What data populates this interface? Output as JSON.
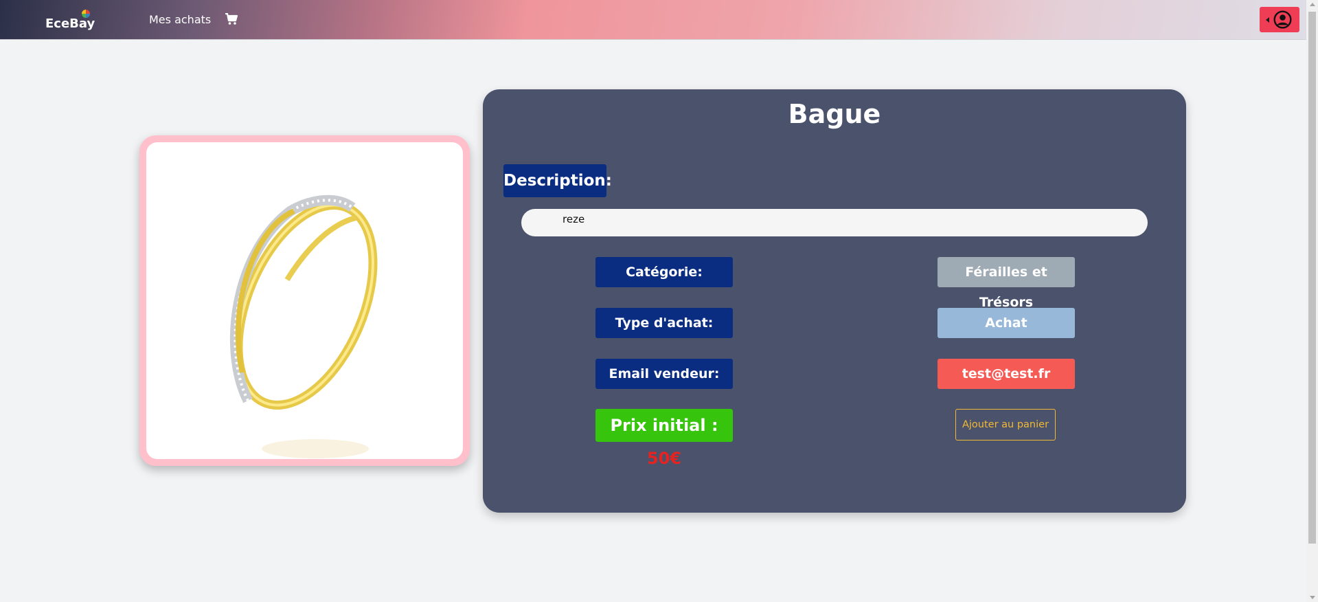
{
  "navbar": {
    "logo_text": "EceBay",
    "links": [
      {
        "label": "Mes achats"
      }
    ],
    "cart_icon": "shopping-cart-icon",
    "user_icon": "user-circle-icon",
    "accent_color": "#ee3d54"
  },
  "product": {
    "title": "Bague",
    "image_icon": "gold-ring-image",
    "description_label": "Description:",
    "description_value": "reze",
    "category_label": "Catégorie:",
    "category_value": "Férailles et Trésors",
    "purchase_type_label": "Type d'achat:",
    "purchase_type_value": "Achat",
    "seller_email_label": "Email vendeur:",
    "seller_email_value": "test@test.fr",
    "price_label": "Prix initial : ",
    "price_value": "50€",
    "add_to_cart_label": "Ajouter au panier"
  },
  "colors": {
    "panel_bg": "#4b526c",
    "label_bg": "#0a2d82",
    "price_bg": "#36c40c",
    "price_text": "#e52320",
    "email_bg": "#f55a55",
    "cart_button_border": "#f1b936",
    "image_frame": "#ffc0cb"
  }
}
